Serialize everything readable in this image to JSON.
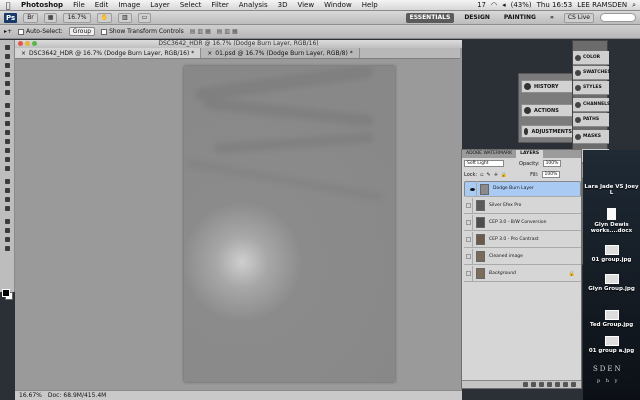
{
  "menubar": {
    "apple": "",
    "app": "Photoshop",
    "items": [
      "File",
      "Edit",
      "Image",
      "Layer",
      "Select",
      "Filter",
      "Analysis",
      "3D",
      "View",
      "Window",
      "Help"
    ],
    "status": {
      "badge": "17",
      "battery": "(43%)",
      "clock": "Thu 16:53",
      "user": "LEE RAMSDEN"
    }
  },
  "appbar": {
    "logo": "Ps",
    "zoom": "16.7%",
    "workspaces": [
      "ESSENTIALS",
      "DESIGN",
      "PAINTING"
    ],
    "more": "»",
    "cs_live": "CS Live"
  },
  "options": {
    "auto_select": "Auto-Select:",
    "auto_select_value": "Group",
    "transform": "Show Transform Controls"
  },
  "document": {
    "window_title": "DSC3642_HDR @ 16.7% (Dodge Burn Layer, RGB/16)",
    "tabs": [
      "DSC3642_HDR @ 16.7% (Dodge Burn Layer, RGB/16) *",
      "01.psd @ 16.7% (Dodge Burn Layer, RGB/8) *"
    ],
    "close": "×"
  },
  "status": {
    "zoom": "16.67%",
    "doc": "Doc: 68.9M/415.4M"
  },
  "mid_dock": [
    "HISTORY",
    "ACTIONS",
    "ADJUSTMENTS"
  ],
  "right_col": [
    "COLOR",
    "SWATCHES",
    "STYLES",
    "CHANNELS",
    "PATHS",
    "MASKS",
    "ADOBE WAT...",
    "LAYERS"
  ],
  "layers_panel": {
    "tabs": [
      "ADOBE WATERMARK",
      "LAYERS"
    ],
    "blend_mode": "Soft Light",
    "opacity_label": "Opacity:",
    "opacity": "100%",
    "lock_label": "Lock:",
    "fill_label": "Fill:",
    "fill": "100%",
    "layers": [
      {
        "name": "Dodge Burn Layer",
        "visible": true,
        "selected": true
      },
      {
        "name": "Silver Efex Pro",
        "visible": false,
        "selected": false
      },
      {
        "name": "CEP 3.0 - B/W Conversion",
        "visible": false,
        "selected": false
      },
      {
        "name": "CEP 3.0 - Pro Contrast",
        "visible": false,
        "selected": false
      },
      {
        "name": "Cleaned image",
        "visible": false,
        "selected": false
      },
      {
        "name": "Background",
        "visible": false,
        "selected": false,
        "locked": true
      }
    ]
  },
  "desktop": {
    "icons": [
      {
        "label": "Lara Jade VS Joey L"
      },
      {
        "label": "Glyn  Dewis works....docx"
      },
      {
        "label": "01 group.jpg"
      },
      {
        "label": "Glyn Group.jpg"
      },
      {
        "label": "Ted Group.jpg"
      },
      {
        "label": "01 group a.jpg"
      }
    ],
    "wordmark1": "SDEN",
    "wordmark2": "p h y"
  }
}
